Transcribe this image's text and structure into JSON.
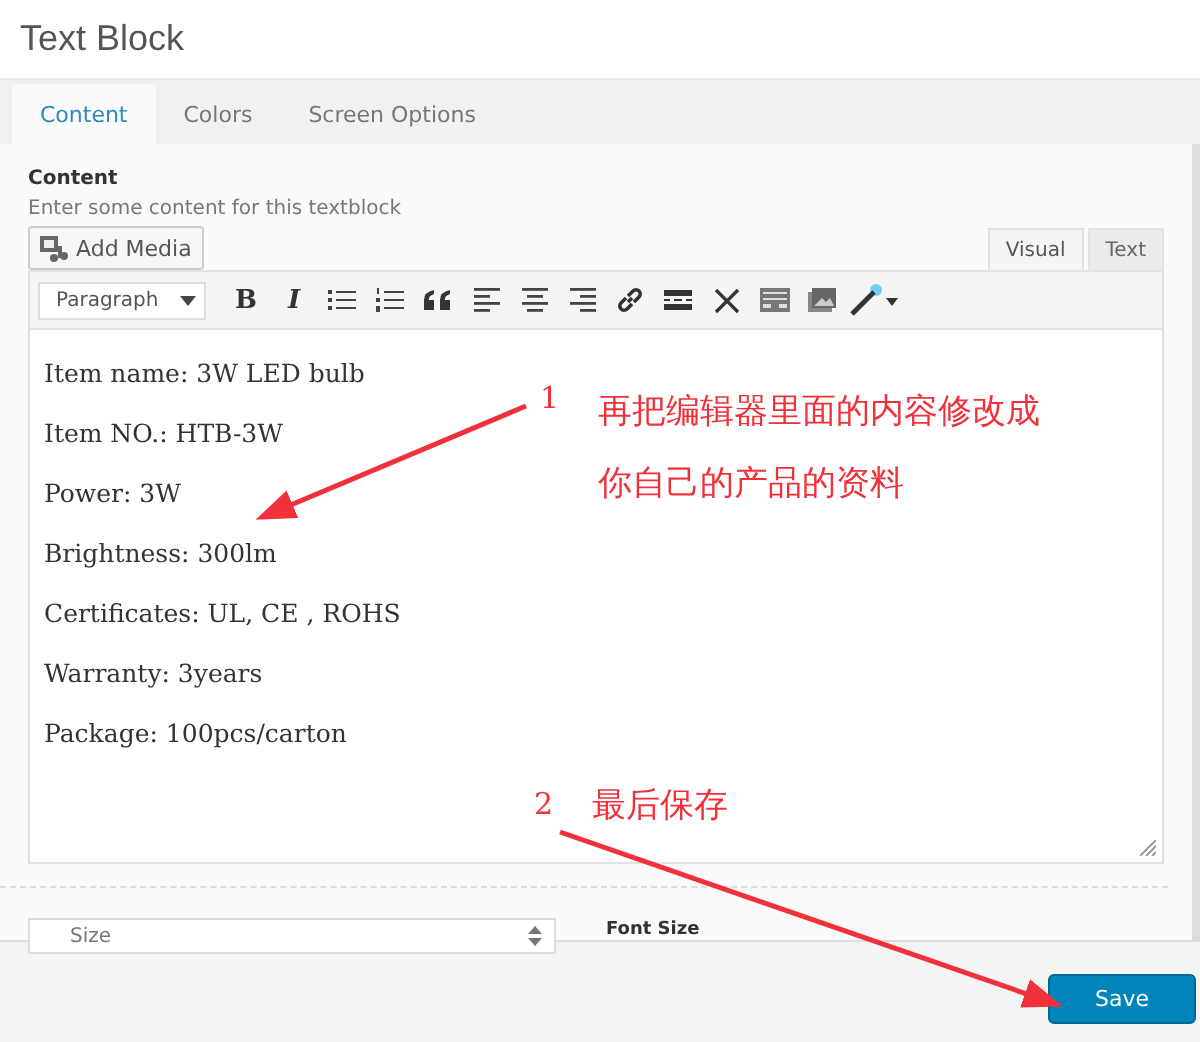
{
  "window": {
    "title": "Text Block"
  },
  "tabs": [
    {
      "label": "Content",
      "selected": true
    },
    {
      "label": "Colors",
      "selected": false
    },
    {
      "label": "Screen Options",
      "selected": false
    }
  ],
  "content": {
    "label": "Content",
    "description": "Enter some content for this textblock",
    "add_media": "Add Media",
    "editor_tabs": [
      {
        "label": "Visual",
        "selected": true
      },
      {
        "label": "Text",
        "selected": false
      }
    ],
    "toolbar": {
      "format": "Paragraph",
      "buttons": [
        {
          "kind": "text",
          "label": "B"
        },
        {
          "kind": "text",
          "label": "I"
        },
        {
          "kind": "bullet-list"
        },
        {
          "kind": "numbered-list"
        },
        {
          "kind": "quote"
        },
        {
          "kind": "align-left"
        },
        {
          "kind": "align-center"
        },
        {
          "kind": "align-right"
        },
        {
          "kind": "link"
        },
        {
          "kind": "more"
        },
        {
          "kind": "fullscreen"
        },
        {
          "kind": "toolbar-toggle"
        },
        {
          "kind": "image"
        },
        {
          "kind": "wand"
        }
      ]
    },
    "paragraphs": [
      "Item name:  3W LED bulb",
      "Item NO.:  HTB-3W",
      "Power: 3W",
      "Brightness:  300lm",
      "Certificates: UL, CE , ROHS",
      "Warranty:  3years",
      "Package:  100pcs/carton"
    ]
  },
  "size_select": {
    "value": "Size"
  },
  "font_size_label": "Font Size",
  "save_button": "Save",
  "annotations": [
    {
      "number": "1",
      "lines": [
        "再把编辑器里面的内容修改成",
        "你自己的产品的资料"
      ]
    },
    {
      "number": "2",
      "lines": [
        "最后保存"
      ]
    }
  ]
}
